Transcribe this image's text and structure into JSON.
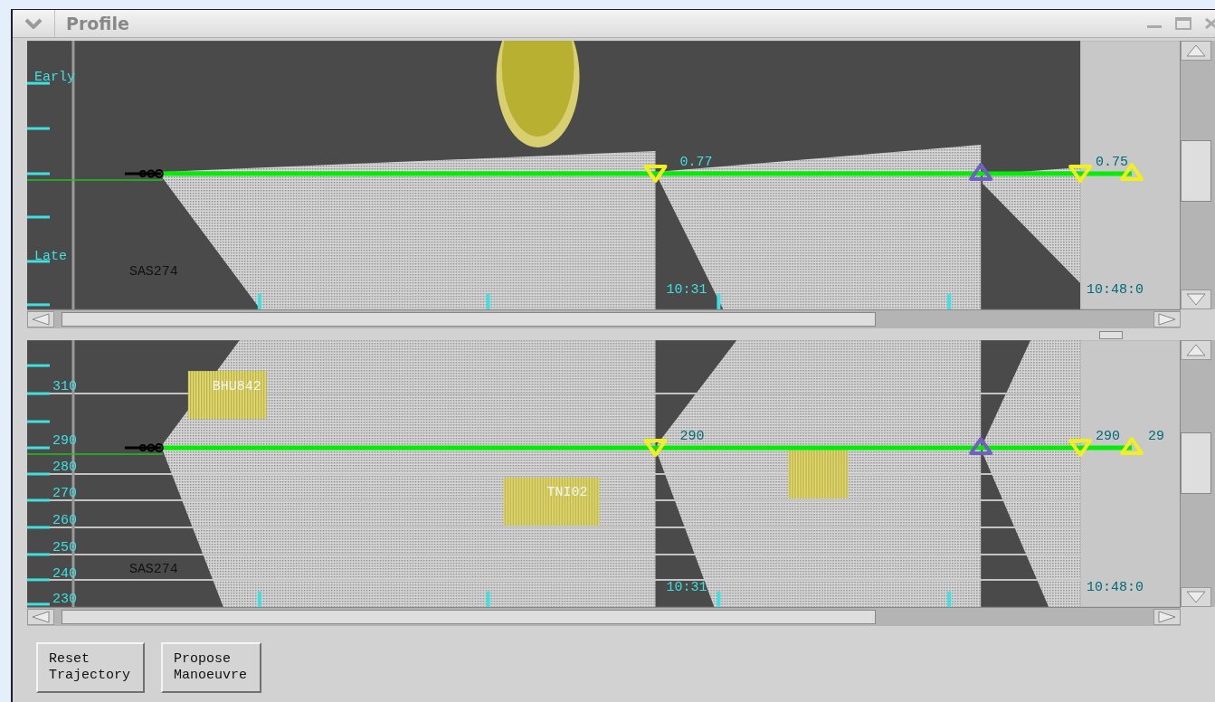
{
  "window": {
    "title": "Profile"
  },
  "panels": [
    {
      "kind": "time",
      "axis_labels": [
        "Early",
        "Late"
      ],
      "flight_label": "SAS274",
      "value_labels": [
        "0.77",
        "0.75"
      ],
      "time_labels": [
        "10:31",
        "10:48:0"
      ]
    },
    {
      "kind": "level",
      "axis_labels": [
        "310",
        "290",
        "280",
        "270",
        "260",
        "250",
        "240",
        "230"
      ],
      "flight_label": "SAS274",
      "traffic_labels": [
        "BHU842",
        "TNI02"
      ],
      "value_labels": [
        "290",
        "290",
        "29"
      ],
      "time_labels": [
        "10:31",
        "10:48:0"
      ]
    }
  ],
  "buttons": [
    "Reset\nTrajectory",
    "Propose\nManoeuvre"
  ]
}
